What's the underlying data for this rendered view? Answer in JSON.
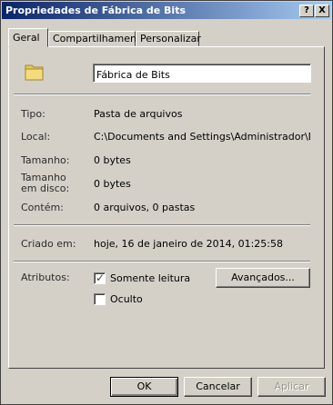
{
  "window": {
    "title": "Propriedades de Fábrica de Bits"
  },
  "titlebar_buttons": {
    "help": "?",
    "close": "X"
  },
  "tabs": [
    {
      "label": "Geral",
      "active": true
    },
    {
      "label": "Compartilhamento",
      "active": false
    },
    {
      "label": "Personalizar",
      "active": false
    }
  ],
  "general": {
    "icon": "folder-icon",
    "name_value": "Fábrica de Bits",
    "type_label": "Tipo:",
    "type_value": "Pasta de arquivos",
    "location_label": "Local:",
    "location_value": "C:\\Documents and Settings\\Administrador\\Deskto",
    "size_label": "Tamanho:",
    "size_value": "0 bytes",
    "disk_size_label_line1": "Tamanho",
    "disk_size_label_line2": "em disco:",
    "disk_size_value": "0 bytes",
    "contains_label": "Contém:",
    "contains_value": "0 arquivos, 0 pastas",
    "created_label": "Criado em:",
    "created_value": "hoje, 16 de janeiro de 2014, 01:25:58",
    "attributes_label": "Atributos:",
    "readonly_label": "Somente leitura",
    "readonly_checked": true,
    "hidden_label": "Oculto",
    "hidden_checked": false,
    "advanced_button": "Avançados..."
  },
  "footer": {
    "ok": "OK",
    "cancel": "Cancelar",
    "apply": "Aplicar"
  },
  "colors": {
    "title_gradient_start": "#0a246a",
    "title_gradient_end": "#a6caf0",
    "face": "#d4d0c8"
  }
}
